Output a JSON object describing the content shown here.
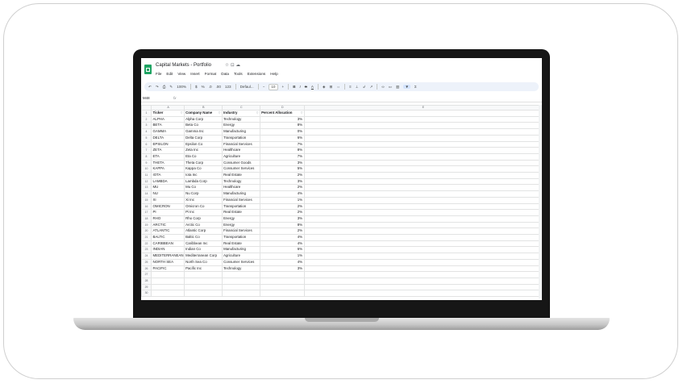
{
  "app": {
    "title": "Capital Markets - Portfolio",
    "menu": [
      "File",
      "Edit",
      "View",
      "Insert",
      "Format",
      "Data",
      "Tools",
      "Extensions",
      "Help"
    ],
    "title_icons": [
      "star-icon",
      "move-icon",
      "cloud-icon"
    ]
  },
  "toolbar": {
    "zoom": "100%",
    "currency": "$",
    "percent": "%",
    "decimal_decrease": ".0",
    "decimal_increase": ".00",
    "number_format": "123",
    "font": "Defaul...",
    "font_size": "10",
    "bold": "B",
    "italic": "I",
    "strike": "S",
    "text_color": "A"
  },
  "formula_bar": {
    "cell_ref": "M48",
    "fx": "fx"
  },
  "sheet": {
    "column_letters": [
      "A",
      "B",
      "C",
      "D",
      "E"
    ],
    "headers": [
      "Ticker",
      "Company Name",
      "Industry",
      "Percent Allocation"
    ],
    "rows": [
      [
        "ALPHA",
        "Alpha Corp",
        "Technology",
        "3%"
      ],
      [
        "BETA",
        "Beta Co",
        "Energy",
        "8%"
      ],
      [
        "GAMMA",
        "Gamma Inc",
        "Manufacturing",
        "0%"
      ],
      [
        "DELTA",
        "Delta Corp",
        "Transportation",
        "6%"
      ],
      [
        "EPSILON",
        "Epsilon Co",
        "Financial Services",
        "7%"
      ],
      [
        "ZETA",
        "Zeta Inc",
        "Healthcare",
        "8%"
      ],
      [
        "ETA",
        "Eta Co",
        "Agriculture",
        "7%"
      ],
      [
        "THETA",
        "Theta Corp",
        "Consumer Goods",
        "3%"
      ],
      [
        "KAPPA",
        "Kappa Co",
        "Consumer Services",
        "5%"
      ],
      [
        "IOTA",
        "Iota Inc",
        "Real Estate",
        "2%"
      ],
      [
        "LAMBDA",
        "Lambda Corp",
        "Technology",
        "3%"
      ],
      [
        "MU",
        "Mu Co",
        "Healthcare",
        "2%"
      ],
      [
        "NU",
        "Nu Corp",
        "Manufacturing",
        "4%"
      ],
      [
        "XI",
        "Xi Inc",
        "Financial Services",
        "1%"
      ],
      [
        "OMICRON",
        "Omicron Co",
        "Transportation",
        "2%"
      ],
      [
        "PI",
        "Pi Inc",
        "Real Estate",
        "2%"
      ],
      [
        "RHO",
        "Rho Corp",
        "Energy",
        "3%"
      ],
      [
        "ARCTIC",
        "Arctic Co",
        "Energy",
        "8%"
      ],
      [
        "ATLANTIC",
        "Atlantic Corp",
        "Financial Services",
        "2%"
      ],
      [
        "BALTIC",
        "Baltic Co",
        "Transportation",
        "4%"
      ],
      [
        "CARIBBEAN",
        "Caribbean Inc",
        "Real Estate",
        "4%"
      ],
      [
        "INDIAN",
        "Indian Co",
        "Manufacturing",
        "6%"
      ],
      [
        "MEDITERRANEAN",
        "Mediterranean Corp",
        "Agriculture",
        "1%"
      ],
      [
        "NORTH SEA",
        "North Sea Co",
        "Consumer Services",
        "4%"
      ],
      [
        "PACIFIC",
        "Pacific Inc",
        "Technology",
        "3%"
      ]
    ],
    "row_numbers": [
      "1",
      "2",
      "3",
      "4",
      "5",
      "6",
      "7",
      "8",
      "9",
      "10",
      "11",
      "12",
      "13",
      "14",
      "15",
      "16",
      "17",
      "18",
      "19",
      "20",
      "21",
      "22",
      "23",
      "24",
      "25",
      "26",
      "27",
      "28",
      "29",
      "30"
    ]
  },
  "colors": {
    "sheets_green": "#1ea362",
    "toolbar_bg": "#edf2fa",
    "grid_line": "#e2e3e3"
  }
}
